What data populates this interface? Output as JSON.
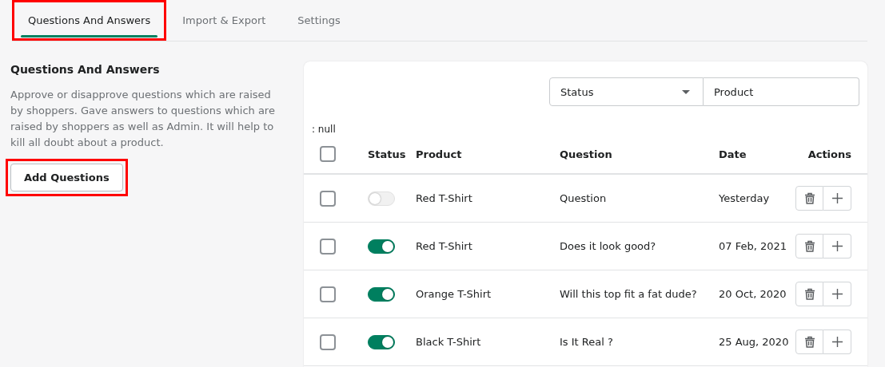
{
  "tabs": [
    {
      "label": "Questions And Answers",
      "selected": true,
      "highlighted": true
    },
    {
      "label": "Import & Export",
      "selected": false,
      "highlighted": false
    },
    {
      "label": "Settings",
      "selected": false,
      "highlighted": false
    }
  ],
  "intro": {
    "title": "Questions And Answers",
    "description": "Approve or disapprove questions which are raised by shoppers. Gave answers to questions which are raised by shoppers as well as Admin. It will help to kill all doubt about a product.",
    "button": {
      "label": "Add Questions",
      "highlighted": true
    }
  },
  "filters": {
    "status": {
      "value": "Status"
    },
    "product": {
      "placeholder": "Product"
    }
  },
  "debug_text": ": null",
  "table": {
    "header_checked": false,
    "columns": [
      "Status",
      "Product",
      "Question",
      "Date",
      "Actions"
    ],
    "rows": [
      {
        "checked": false,
        "on": false,
        "product": "Red T-Shirt",
        "question": "Question",
        "date": "Yesterday"
      },
      {
        "checked": false,
        "on": true,
        "product": "Red T-Shirt",
        "question": "Does it look good?",
        "date": "07 Feb, 2021"
      },
      {
        "checked": false,
        "on": true,
        "product": "Orange T-Shirt",
        "question": "Will this top fit a fat dude?",
        "date": "20 Oct, 2020"
      },
      {
        "checked": false,
        "on": true,
        "product": "Black T-Shirt",
        "question": "Is It Real ?",
        "date": "25 Aug, 2020"
      }
    ]
  }
}
